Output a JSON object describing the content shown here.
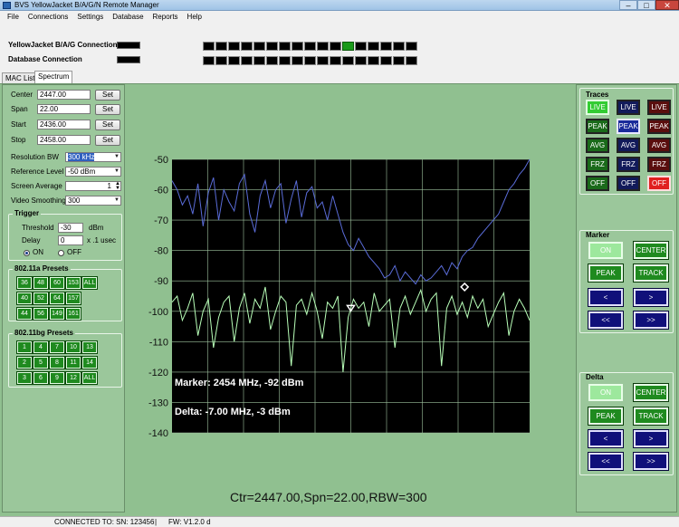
{
  "window": {
    "title": "BVS YellowJacket B/A/G/N Remote Manager",
    "minimize": "–",
    "maximize": "□",
    "close": "✕"
  },
  "menu": [
    "File",
    "Connections",
    "Settings",
    "Database",
    "Reports",
    "Help"
  ],
  "header": {
    "yj_connection_label": "YellowJacket B/A/G Connection",
    "db_connection_label": "Database Connection"
  },
  "tabs": [
    "MAC List",
    "Spectrum"
  ],
  "controls": {
    "center_label": "Center",
    "center_value": "2447.00",
    "span_label": "Span",
    "span_value": "22.00",
    "start_label": "Start",
    "start_value": "2436.00",
    "stop_label": "Stop",
    "stop_value": "2458.00",
    "set_label": "Set",
    "rbw_label": "Resolution BW",
    "rbw_value": "300 kHz",
    "ref_label": "Reference Level",
    "ref_value": "-50 dBm",
    "screen_avg_label": "Screen Average",
    "screen_avg_value": "1",
    "video_label": "Video Smoothing",
    "video_value": "300"
  },
  "trigger": {
    "title": "Trigger",
    "threshold_label": "Threshold",
    "threshold_value": "-30",
    "threshold_unit": "dBm",
    "delay_label": "Delay",
    "delay_value": "0",
    "delay_unit": "x .1 usec",
    "on_label": "ON",
    "off_label": "OFF"
  },
  "presets_a": {
    "title": "802.11a Presets",
    "rows": [
      [
        "36",
        "48",
        "60",
        "153",
        "ALL"
      ],
      [
        "40",
        "52",
        "64",
        "157"
      ],
      [
        "44",
        "56",
        "149",
        "161"
      ]
    ]
  },
  "presets_bg": {
    "title": "802.11bg Presets",
    "rows": [
      [
        "1",
        "4",
        "7",
        "10",
        "13"
      ],
      [
        "2",
        "5",
        "8",
        "11",
        "14"
      ],
      [
        "3",
        "6",
        "9",
        "12",
        "ALL"
      ]
    ]
  },
  "traces": {
    "title": "Traces",
    "rows": [
      [
        "LIVE",
        "LIVE",
        "LIVE"
      ],
      [
        "PEAK",
        "PEAK",
        "PEAK"
      ],
      [
        "AVG",
        "AVG",
        "AVG"
      ],
      [
        "FRZ",
        "FRZ",
        "FRZ"
      ],
      [
        "OFF",
        "OFF",
        "OFF"
      ]
    ]
  },
  "marker": {
    "title": "Marker",
    "on": "ON",
    "center": "CENTER",
    "peak": "PEAK",
    "track": "TRACK",
    "left": "<",
    "right": ">",
    "fast_left": "<<",
    "fast_right": ">>"
  },
  "delta": {
    "title": "Delta",
    "on": "ON",
    "center": "CENTER",
    "peak": "PEAK",
    "track": "TRACK",
    "left": "<",
    "right": ">",
    "fast_left": "<<",
    "fast_right": ">>"
  },
  "chart_data": {
    "type": "line",
    "ylim": [
      -140,
      -50
    ],
    "yticks": [
      "-50",
      "-60",
      "-70",
      "-80",
      "-90",
      "-100",
      "-110",
      "-120",
      "-130",
      "-140"
    ],
    "grid": true,
    "x_range_mhz": [
      2436,
      2458
    ],
    "marker_text": "Marker: 2454 MHz, -92 dBm",
    "delta_text": "Delta: -7.00 MHz, -3 dBm",
    "marker_point": {
      "x": 2454,
      "y": -92
    },
    "delta_point": {
      "x": 2447,
      "y": -99
    },
    "series": [
      {
        "values": [
          -57,
          -60,
          -65,
          -62,
          -68,
          -58,
          -72,
          -61,
          -56,
          -70,
          -60,
          -64,
          -67,
          -58,
          -55,
          -68,
          -74,
          -62,
          -57,
          -66,
          -60,
          -58,
          -71,
          -63,
          -57,
          -69,
          -61,
          -59,
          -66,
          -64,
          -70,
          -62,
          -68,
          -74,
          -78,
          -80,
          -76,
          -79,
          -82,
          -84,
          -86,
          -89,
          -88,
          -85,
          -90,
          -87,
          -89,
          -91,
          -88,
          -90,
          -89,
          -87,
          -85,
          -88,
          -84,
          -86,
          -82,
          -80,
          -79,
          -76,
          -74,
          -72,
          -70,
          -68,
          -64,
          -60,
          -58,
          -55,
          -53,
          -50
        ]
      },
      {
        "values": [
          -97,
          -95,
          -103,
          -99,
          -94,
          -108,
          -100,
          -96,
          -112,
          -102,
          -97,
          -95,
          -110,
          -99,
          -94,
          -104,
          -96,
          -99,
          -92,
          -106,
          -100,
          -95,
          -97,
          -118,
          -98,
          -96,
          -101,
          -94,
          -100,
          -109,
          -97,
          -99,
          -95,
          -120,
          -102,
          -96,
          -99,
          -97,
          -105,
          -94,
          -100,
          -98,
          -96,
          -112,
          -99,
          -95,
          -101,
          -97,
          -93,
          -100,
          -96,
          -94,
          -118,
          -99,
          -95,
          -101,
          -97,
          -102,
          -95,
          -99,
          -96,
          -105,
          -101,
          -97,
          -94,
          -108,
          -100,
          -96,
          -99,
          -103
        ]
      }
    ]
  },
  "caption": "Ctr=2447.00,Spn=22.00,RBW=300",
  "status": {
    "connected": "CONNECTED TO: SN: 123456",
    "sep": "|",
    "fw": "FW: V1.2.0  d"
  },
  "colors": {
    "background": "#90c090",
    "plot_bg": "#000000",
    "trace_live": "#5a6cd8",
    "trace_avg": "#b8ffb8"
  }
}
